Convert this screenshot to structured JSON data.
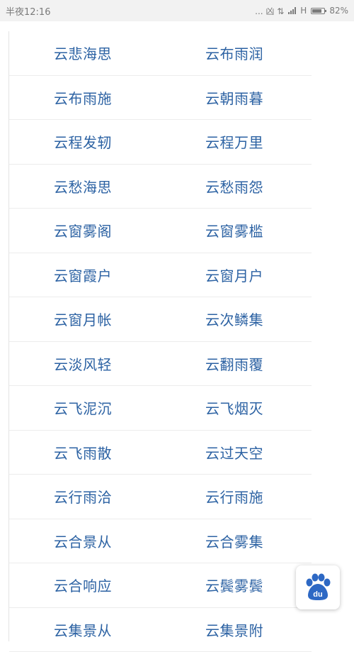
{
  "status_bar": {
    "time": "半夜12:16",
    "signal_text": "... 凶 ⇅",
    "network": "H",
    "battery_level_percent": 82,
    "battery": "82%"
  },
  "rows": [
    [
      "云悲海思",
      "云布雨润"
    ],
    [
      "云布雨施",
      "云朝雨暮"
    ],
    [
      "云程发轫",
      "云程万里"
    ],
    [
      "云愁海思",
      "云愁雨怨"
    ],
    [
      "云窗雾阁",
      "云窗雾槛"
    ],
    [
      "云窗霞户",
      "云窗月户"
    ],
    [
      "云窗月帐",
      "云次鳞集"
    ],
    [
      "云淡风轻",
      "云翻雨覆"
    ],
    [
      "云飞泥沉",
      "云飞烟灭"
    ],
    [
      "云飞雨散",
      "云过天空"
    ],
    [
      "云行雨洽",
      "云行雨施"
    ],
    [
      "云合景从",
      "云合雾集"
    ],
    [
      "云合响应",
      "云鬓雾鬓"
    ],
    [
      "云集景从",
      "云集景附"
    ]
  ],
  "fab": {
    "icon": "baidu-paw-icon",
    "label": "du",
    "color": "#2d68c4"
  }
}
